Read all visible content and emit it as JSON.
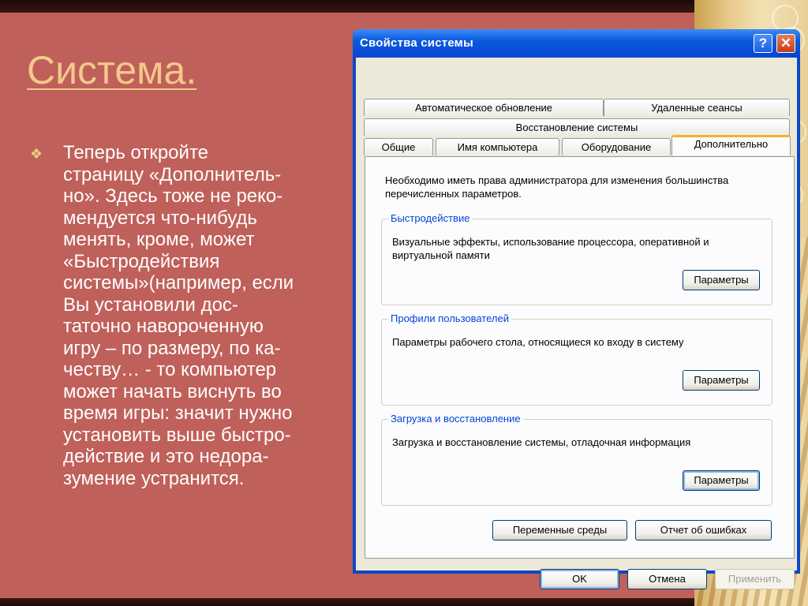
{
  "slide": {
    "title": "Система.",
    "body": "Теперь откройте\nстраницу «Дополнитель-\nно». Здесь тоже не реко-\nмендуется что-нибудь\nменять, кроме, может\n«Быстродействия\nсистемы»(например, если\nВы установили дос-\nтаточно навороченную\nигру – по размеру, по ка-\nчеству… - то компьютер\nможет начать виснуть во\nвремя игры: значит нужно\nустановить выше быстро-\nдействие и это недора-\nзумение устранится.",
    "bullet_icon": "bullet-icon",
    "colors": {
      "background": "#c0605a",
      "title": "#f2c98a",
      "text": "#ffffff"
    }
  },
  "dialog": {
    "title": "Свойства системы",
    "help_label": "?",
    "close_label": "✕",
    "tabs_row1": [
      "Автоматическое обновление",
      "Удаленные сеансы"
    ],
    "tabs_row2": [
      "Восстановление системы"
    ],
    "tabs_row3": [
      "Общие",
      "Имя компьютера",
      "Оборудование",
      "Дополнительно"
    ],
    "active_tab": "Дополнительно",
    "note": "Необходимо иметь права администратора для изменения большинства перечисленных параметров.",
    "groups": [
      {
        "title": "Быстродействие",
        "desc": "Визуальные эффекты, использование процессора, оперативной и виртуальной памяти",
        "button": "Параметры"
      },
      {
        "title": "Профили пользователей",
        "desc": "Параметры рабочего стола, относящиеся ко входу в систему",
        "button": "Параметры"
      },
      {
        "title": "Загрузка и восстановление",
        "desc": "Загрузка и восстановление системы, отладочная информация",
        "button": "Параметры"
      }
    ],
    "env_button": "Переменные среды",
    "error_button": "Отчет об ошибках",
    "ok_button": "OK",
    "cancel_button": "Отмена",
    "apply_button": "Применить"
  }
}
